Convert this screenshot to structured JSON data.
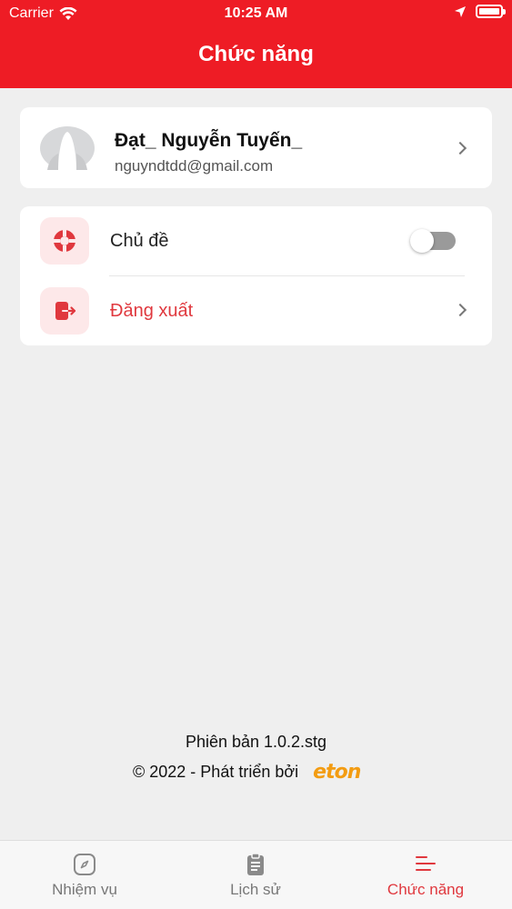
{
  "status_bar": {
    "carrier": "Carrier",
    "time": "10:25 AM"
  },
  "header": {
    "title": "Chức năng"
  },
  "profile": {
    "name": "Đạt_ Nguyễn Tuyến_",
    "email": "nguyndtdd@gmail.com"
  },
  "menu": {
    "theme_label": "Chủ đề",
    "theme_enabled": false,
    "logout_label": "Đăng xuất"
  },
  "footer": {
    "version": "Phiên bản 1.0.2.stg",
    "copyright": "© 2022 - Phát triển bởi",
    "brand": "eton"
  },
  "tabs": [
    {
      "label": "Nhiệm vụ",
      "icon": "compass-icon",
      "active": false
    },
    {
      "label": "Lịch sử",
      "icon": "clipboard-icon",
      "active": false
    },
    {
      "label": "Chức năng",
      "icon": "menu-lines-icon",
      "active": true
    }
  ],
  "colors": {
    "primary": "#ee1c25",
    "accent_text": "#e0383e",
    "icon_bg": "#fde8e9",
    "background": "#efefef",
    "brand_orange": "#f39c12"
  }
}
